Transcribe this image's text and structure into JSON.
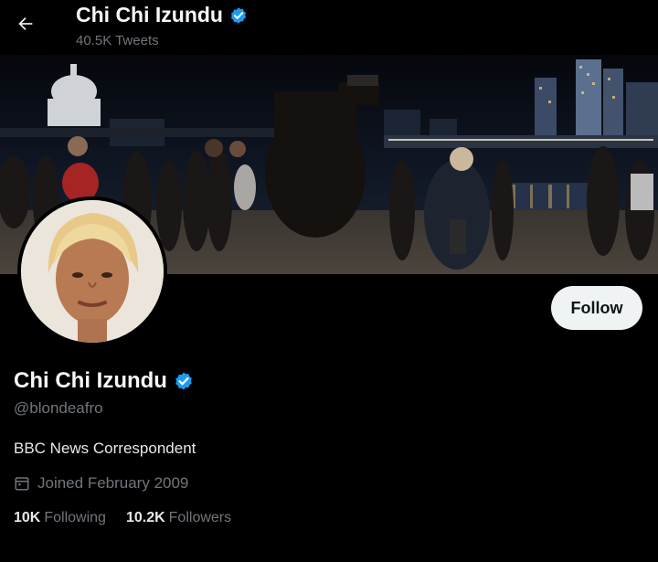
{
  "header": {
    "display_name": "Chi Chi Izundu",
    "tweet_count": "40.5K Tweets"
  },
  "profile": {
    "display_name": "Chi Chi Izundu",
    "handle": "@blondeafro",
    "bio": "BBC News Correspondent",
    "joined": "Joined February 2009",
    "following_count": "10K",
    "following_label": "Following",
    "followers_count": "10.2K",
    "followers_label": "Followers"
  },
  "actions": {
    "follow_label": "Follow"
  },
  "icons": {
    "back": "arrow-left-icon",
    "verified": "verified-badge-icon",
    "calendar": "calendar-icon"
  },
  "colors": {
    "background": "#000000",
    "verified": "#1d9bf0",
    "muted_text": "#71767b",
    "follow_bg": "#eff3f4"
  }
}
